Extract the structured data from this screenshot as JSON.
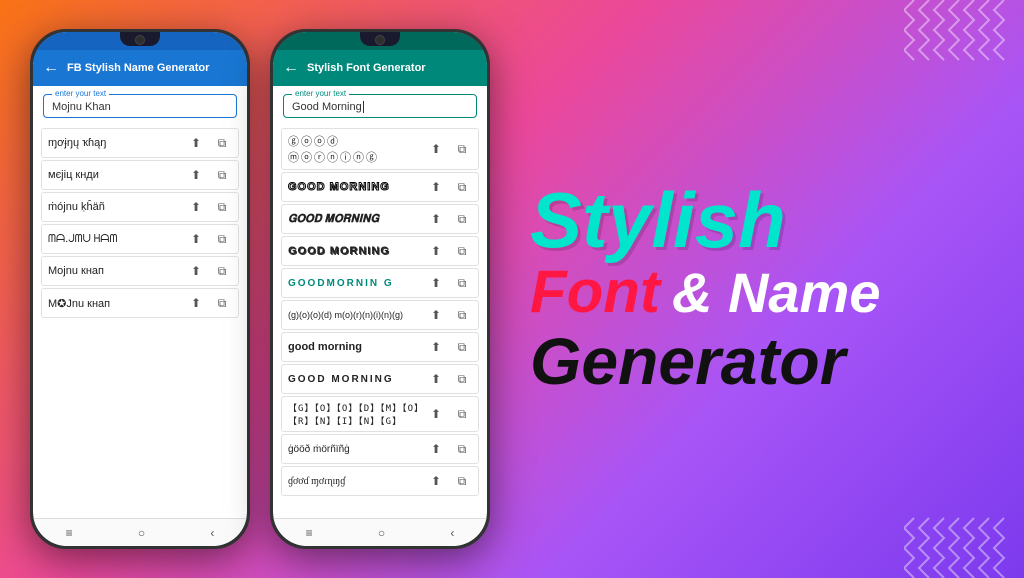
{
  "background": {
    "gradient": "linear-gradient(135deg, #f97316 0%, #ec4899 40%, #a855f7 70%, #7c3aed 100%)"
  },
  "phone1": {
    "status_bar_color": "#1565c0",
    "app_bar_color": "#1976d2",
    "title": "FB Stylish Name Generator",
    "back_icon": "←",
    "input_label": "enter your text",
    "input_value": "Mojnu Khan",
    "items": [
      {
        "text": "ɱơɉŋų ҡɦąŋ",
        "style": "font1"
      },
      {
        "text": "мєjiц кнди",
        "style": "font2"
      },
      {
        "text": "ṁójnu ḳĥäñ",
        "style": "font3"
      },
      {
        "text": "ᗰᗩ.ᒍᗰᑌ ᕼᗩᗰ",
        "style": "font4"
      },
      {
        "text": "Mojnu кнап",
        "style": "font5"
      },
      {
        "text": "M✪Jnu кнап",
        "style": "font6"
      }
    ],
    "nav": [
      "≡",
      "○",
      "‹"
    ]
  },
  "phone2": {
    "status_bar_color": "#00695c",
    "app_bar_color": "#00897b",
    "title": "Stylish Font Generator",
    "back_icon": "←",
    "input_label": "enter your text",
    "input_value": "Good Morning",
    "items": [
      {
        "text": "ⓖⓞⓞⓓ ⓜⓞⓡⓝⓘⓝⓖ",
        "style": "circles"
      },
      {
        "text": "GOOD MORNING",
        "style": "outline"
      },
      {
        "text": "𝐆𝐎𝐎𝐃 𝐌𝐎𝐑𝐍𝐈𝐍𝐆",
        "style": "bold-italic"
      },
      {
        "text": "GOOD MORNING",
        "style": "chunky"
      },
      {
        "text": "GOODMORNIN G",
        "style": "teal"
      },
      {
        "text": "(g)(o)(o)(d) m(o)(r)(n)(i)(n)(g)",
        "style": "parentheses"
      },
      {
        "text": "good morning",
        "style": "bold-sm"
      },
      {
        "text": "GOOD MORNING",
        "style": "allcaps"
      },
      {
        "text": "【G】【O】【O】【D】【M】【O】【R】【N】【I】【N】【G】",
        "style": "boxed"
      },
      {
        "text": "ġööð ṁörñïñġ",
        "style": "dots"
      },
      {
        "text": "ɠơơɗ ɱơɾɳıŋɠ",
        "style": "script"
      }
    ],
    "nav": [
      "≡",
      "○",
      "‹"
    ]
  },
  "hero": {
    "line1": "Stylish",
    "line2_font": "Font",
    "line2_and": "& Name",
    "line3": "Generator"
  },
  "icons": {
    "share": "⬆",
    "copy": "⧉",
    "back": "←"
  }
}
